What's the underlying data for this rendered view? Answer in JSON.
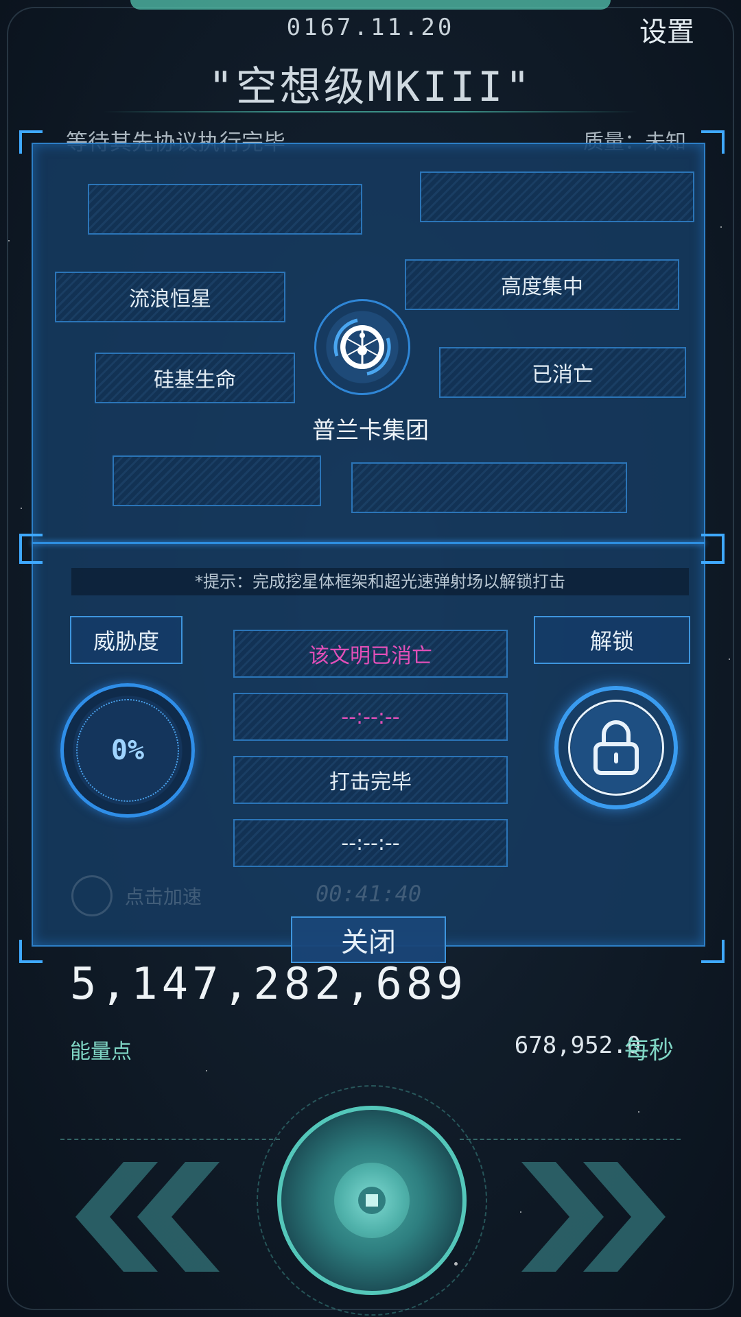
{
  "header": {
    "date": "0167.11.20",
    "settings_label": "设置",
    "ship_name": "\"空想级MKIII\"",
    "status_text_behind": "等待其先协议执行完毕",
    "quality_text_behind": "质量：未知"
  },
  "panel": {
    "slots": [
      {
        "label": ""
      },
      {
        "label": ""
      },
      {
        "label": "流浪恒星"
      },
      {
        "label": "高度集中"
      },
      {
        "label": "硅基生命"
      },
      {
        "label": "已消亡"
      },
      {
        "label": ""
      },
      {
        "label": ""
      }
    ],
    "emblem_name": "普兰卡集团",
    "hint": "*提示：完成挖星体框架和超光速弹射场以解锁打击",
    "threat_label": "威胁度",
    "threat_value": "0%",
    "unlock_label": "解锁",
    "status_rows": [
      {
        "text": "该文明已消亡",
        "color": "#e24fb8"
      },
      {
        "text": "--:--:--",
        "color": "#e24fb8"
      },
      {
        "text": "打击完毕",
        "color": "#e6f0f8"
      },
      {
        "text": "--:--:--",
        "color": "#e6f0f8"
      }
    ],
    "speed_label_behind": "点击加速",
    "timer_behind": "00:41:40",
    "close_label": "关闭"
  },
  "resources": {
    "energy_value": "5,147,282,689",
    "energy_label": "能量点",
    "rate_value": "678,952.0",
    "rate_unit": "每秒"
  },
  "icons": [
    "settings-icon",
    "emblem-icon",
    "lock-icon",
    "prev-arrow-icon",
    "next-arrow-icon",
    "main-action-icon"
  ],
  "colors": {
    "accent": "#3fa9ff",
    "teal": "#54c7ba",
    "alert": "#e24fb8"
  }
}
